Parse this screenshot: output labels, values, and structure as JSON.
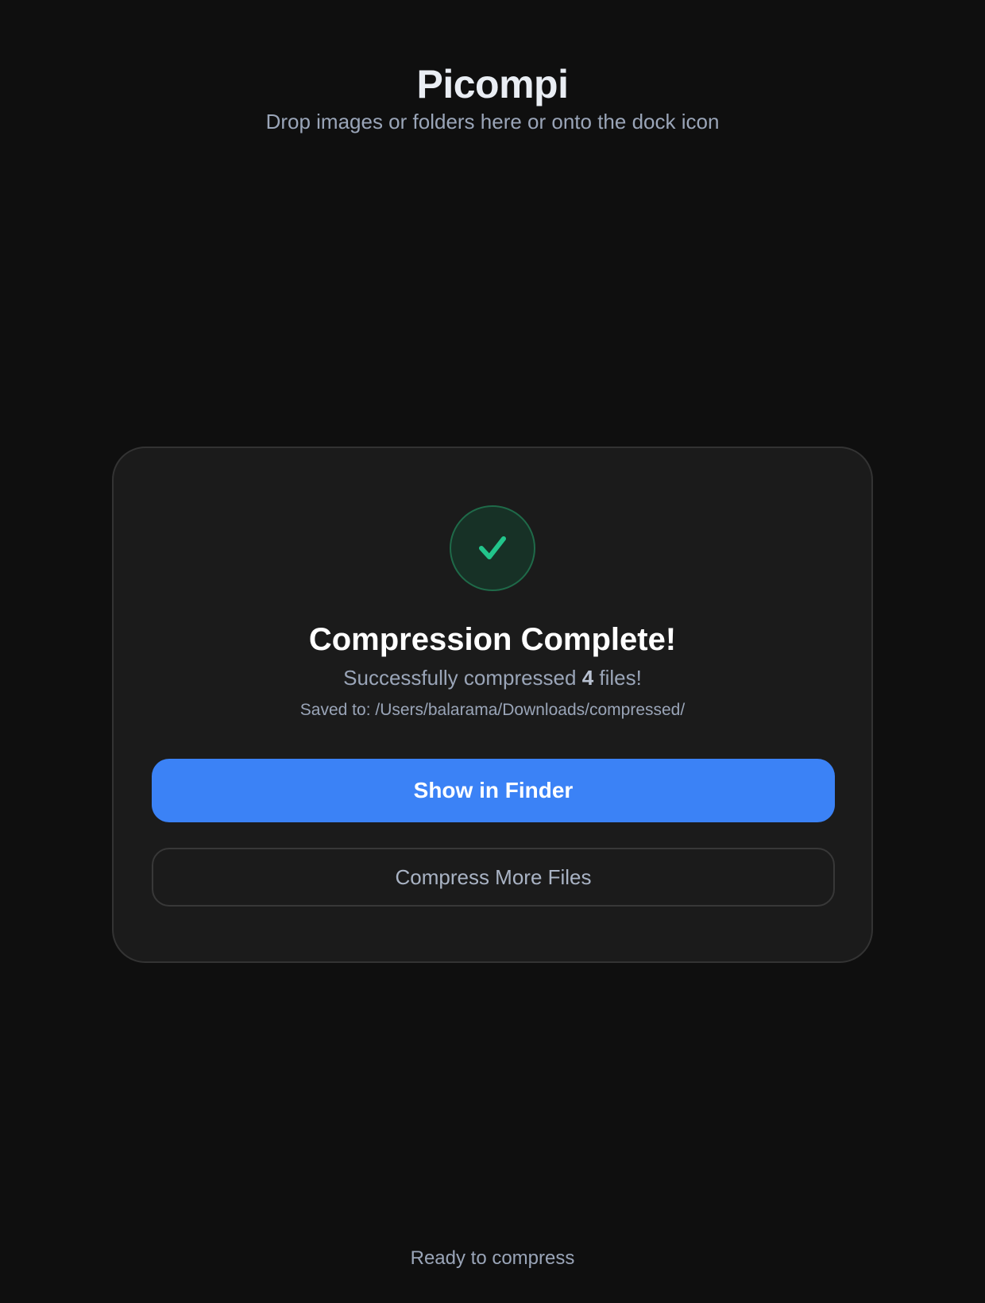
{
  "app": {
    "title": "Picompi",
    "subtitle": "Drop images or folders here or onto the dock icon"
  },
  "result": {
    "icon": "checkmark-icon",
    "title": "Compression Complete!",
    "summary_prefix": "Successfully compressed ",
    "file_count": "4",
    "summary_suffix": " files!",
    "saved_path": "Saved to: /Users/balarama/Downloads/compressed/"
  },
  "actions": {
    "show_in_finder_label": "Show in Finder",
    "compress_more_label": "Compress More Files"
  },
  "status": {
    "text": "Ready to compress"
  },
  "colors": {
    "background": "#0f0f0f",
    "card": "#1b1b1b",
    "accent": "#3b82f6",
    "success": "#22c58b"
  }
}
